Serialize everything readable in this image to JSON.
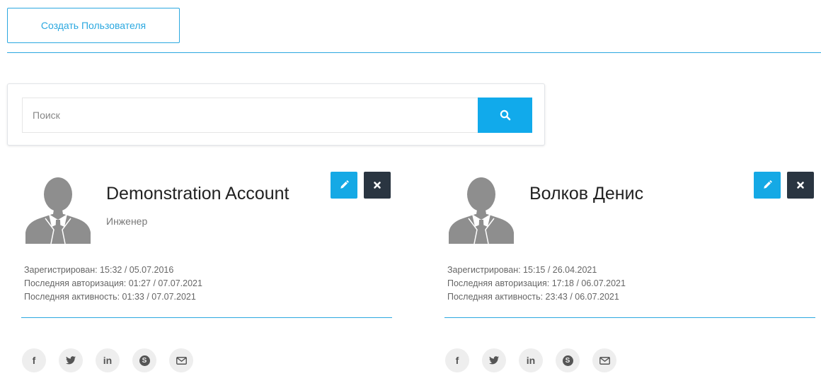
{
  "toolbar": {
    "create_user_label": "Создать Пользователя"
  },
  "search": {
    "placeholder": "Поиск",
    "value": ""
  },
  "users": [
    {
      "name": "Demonstration Account",
      "role": "Инженер",
      "registered": "Зарегистрирован: 15:32 / 05.07.2016",
      "last_login": "Последняя авторизация: 01:27 / 07.07.2021",
      "last_activity": "Последняя активность: 01:33 / 07.07.2021"
    },
    {
      "name": "Волков Денис",
      "role": "",
      "registered": "Зарегистрирован: 15:15 / 26.04.2021",
      "last_login": "Последняя авторизация: 17:18 / 06.07.2021",
      "last_activity": "Последняя активность: 23:43 / 06.07.2021"
    }
  ],
  "social_icons": {
    "facebook": "f",
    "twitter": "twitter-icon",
    "linkedin": "in",
    "skype": "S",
    "email": "envelope-icon"
  },
  "colors": {
    "accent": "#2ba8e0",
    "search_button": "#11aaeb",
    "edit_button": "#15a9e5",
    "delete_button": "#2a3541",
    "social_bg": "#eeeeee"
  }
}
